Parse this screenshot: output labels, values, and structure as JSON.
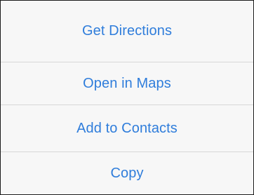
{
  "action_sheet": {
    "accent_color": "#2f7ddb",
    "items": [
      {
        "label": "Get Directions"
      },
      {
        "label": "Open in Maps"
      },
      {
        "label": "Add to Contacts"
      },
      {
        "label": "Copy"
      }
    ]
  }
}
